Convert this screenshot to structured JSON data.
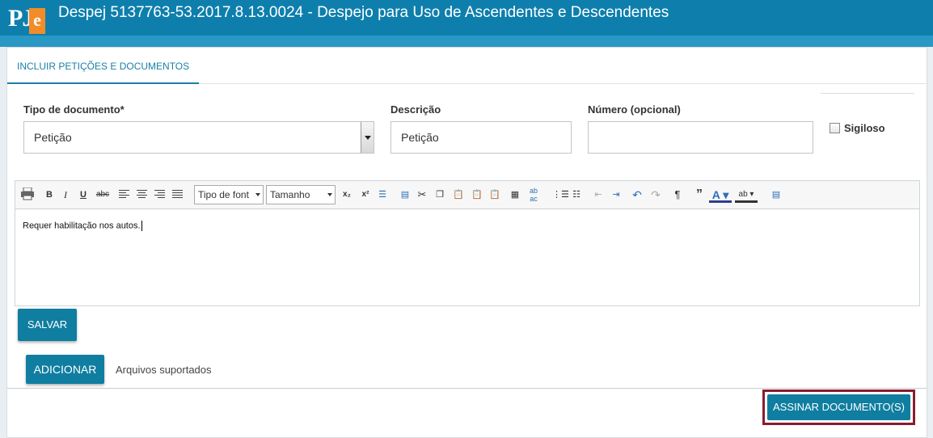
{
  "header": {
    "logo_text": "PJ",
    "logo_e": "e",
    "title": "Despej 5137763-53.2017.8.13.0024 - Despejo para Uso de Ascendentes e Descendentes"
  },
  "tabs": [
    {
      "label": "INCLUIR PETIÇÕES E DOCUMENTOS",
      "active": true
    }
  ],
  "form": {
    "tipo_label": "Tipo de documento*",
    "tipo_value": "Petição",
    "descricao_label": "Descrição",
    "descricao_value": "Petição",
    "numero_label": "Número (opcional)",
    "numero_value": "",
    "sigiloso_label": "Sigiloso",
    "sigiloso_checked": false
  },
  "editor": {
    "font_select": "Tipo de font",
    "size_select": "Tamanho",
    "content": "Requer habilitação nos autos."
  },
  "buttons": {
    "salvar": "SALVAR",
    "adicionar": "ADICIONAR",
    "assinar": "ASSINAR DOCUMENTO(S)"
  },
  "arquivos_label": "Arquivos suportados",
  "colors": {
    "header": "#0e7fad",
    "accent": "#0f7ea0",
    "highlight_border": "#8b1a2e"
  }
}
